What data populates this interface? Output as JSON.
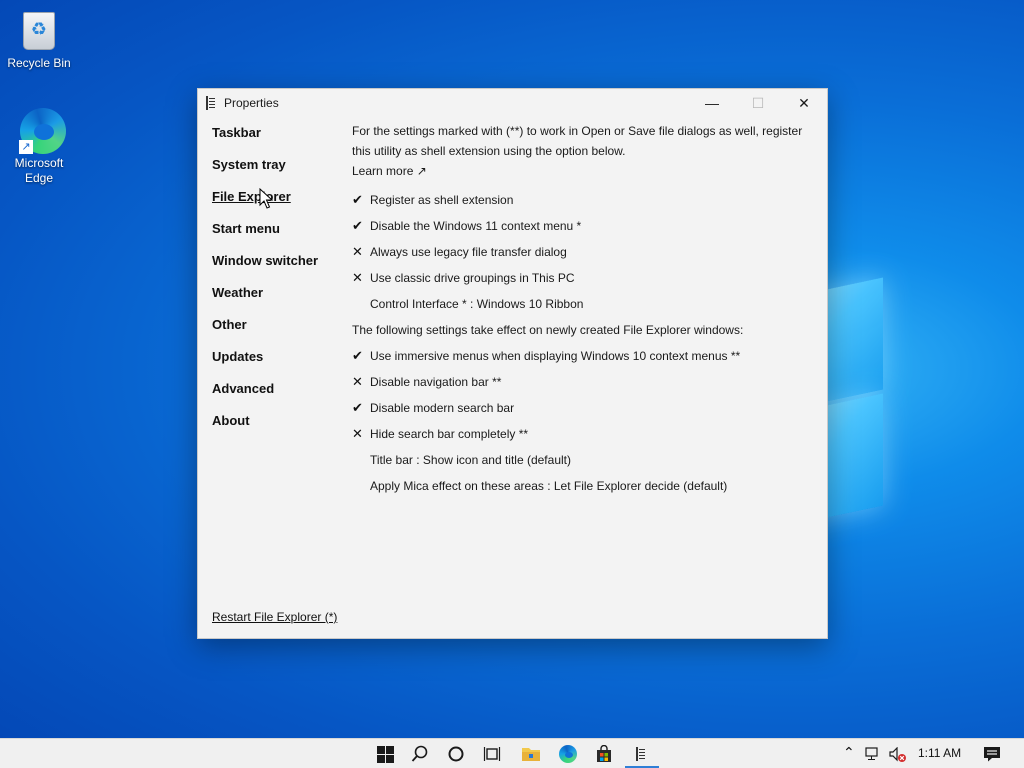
{
  "desktop": {
    "icons": [
      {
        "label": "Recycle Bin",
        "icon": "recycle-bin-icon"
      },
      {
        "label": "Microsoft Edge",
        "icon": "edge-icon"
      }
    ]
  },
  "window": {
    "title": "Properties",
    "minimize": "—",
    "maximize": "☐",
    "close": "✕"
  },
  "nav": {
    "items": [
      "Taskbar",
      "System tray",
      "File Explorer",
      "Start menu",
      "Window switcher",
      "Weather",
      "Other",
      "Updates",
      "Advanced",
      "About"
    ],
    "active": "File Explorer"
  },
  "content": {
    "intro": "For the settings marked with (**) to work in Open or Save file dialogs as well, register this utility as shell extension using the option below.",
    "learn_more": "Learn more ↗",
    "options_group1": [
      {
        "mark": "✔",
        "label": "Register as shell extension",
        "checked": true
      },
      {
        "mark": "✔",
        "label": "Disable the Windows 11 context menu *",
        "checked": true
      },
      {
        "mark": "✕",
        "label": "Always use legacy file transfer dialog",
        "checked": false
      },
      {
        "mark": "✕",
        "label": "Use classic drive groupings in This PC",
        "checked": false
      }
    ],
    "control_interface": "Control Interface * : Windows 10 Ribbon",
    "note": "The following settings take effect on newly created File Explorer windows:",
    "options_group2": [
      {
        "mark": "✔",
        "label": "Use immersive menus when displaying Windows 10 context menus **",
        "checked": true
      },
      {
        "mark": "✕",
        "label": "Disable navigation bar **",
        "checked": false
      },
      {
        "mark": "✔",
        "label": "Disable modern search bar",
        "checked": true
      },
      {
        "mark": "✕",
        "label": "Hide search bar completely **",
        "checked": false
      }
    ],
    "title_bar": "Title bar : Show icon and title (default)",
    "mica": "Apply Mica effect on these areas : Let File Explorer decide (default)"
  },
  "footer": {
    "restart_link": "Restart File Explorer (*)"
  },
  "taskbar": {
    "clock": "1:11 AM",
    "icons": [
      "start-icon",
      "search-icon",
      "cortana-icon",
      "task-view-icon",
      "file-explorer-icon",
      "edge-icon",
      "store-icon",
      "properties-app-icon"
    ]
  },
  "colors": {
    "accent": "#2f7fd6",
    "window_bg": "#f3f3f3"
  }
}
